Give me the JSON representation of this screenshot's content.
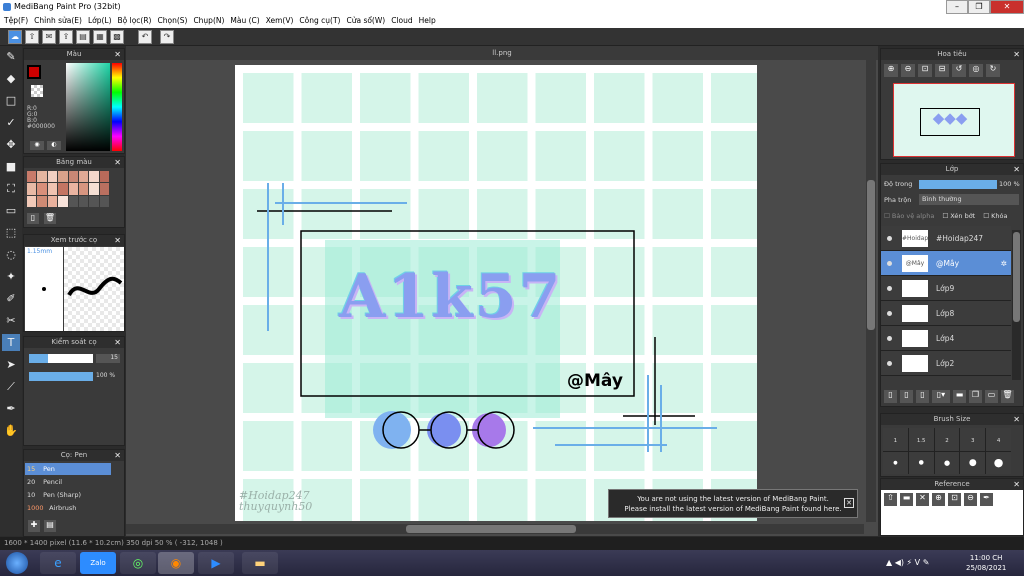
{
  "window": {
    "title": "MediBang Paint Pro (32bit)"
  },
  "menu": [
    "Tệp(F)",
    "Chỉnh sửa(E)",
    "Lớp(L)",
    "Bộ lọc(R)",
    "Chọn(S)",
    "Chụp(N)",
    "Màu (C)",
    "Xem(V)",
    "Công cụ(T)",
    "Cửa sổ(W)",
    "Cloud",
    "Help"
  ],
  "panels": {
    "color": {
      "title": "Màu",
      "r": "R:0",
      "g": "G:0",
      "b": "B:0",
      "hex": "#000000"
    },
    "palette": {
      "title": "Bảng màu"
    },
    "preview": {
      "title": "Xem trước cọ",
      "size": "1.15mm"
    },
    "brushctl": {
      "title": "Kiểm soát cọ",
      "size": "15",
      "opacity": "100 %"
    },
    "brush": {
      "title": "Cọ: Pen",
      "items": [
        {
          "size": "15",
          "name": "Pen"
        },
        {
          "size": "20",
          "name": "Pencil"
        },
        {
          "size": "10",
          "name": "Pen (Sharp)"
        },
        {
          "size": "1000",
          "name": "Airbrush"
        }
      ]
    }
  },
  "document": {
    "tab": "ll.png",
    "title_art": "A1k57",
    "handle": "@Mây",
    "credit1": "#Hoidap247",
    "credit2": "thuyquynh50"
  },
  "navigator": {
    "title": "Hoa tiêu"
  },
  "layers": {
    "title": "Lớp",
    "opacity_label": "Độ trong",
    "opacity": "100 %",
    "blend_label": "Pha trộn",
    "blend": "Bình thường",
    "protect": "Bảo vệ alpha",
    "clip": "Xén bớt",
    "lock": "Khóa",
    "items": [
      {
        "name": "#Hoidap247",
        "thumb": "#Hoidap"
      },
      {
        "name": "@Mây",
        "thumb": "@Mây"
      },
      {
        "name": "Lớp9",
        "thumb": ""
      },
      {
        "name": "Lớp8",
        "thumb": ""
      },
      {
        "name": "Lớp4",
        "thumb": ""
      },
      {
        "name": "Lớp2",
        "thumb": ""
      }
    ]
  },
  "brushsize": {
    "title": "Brush Size",
    "values": [
      "1",
      "1.5",
      "2",
      "3",
      "4"
    ]
  },
  "reference": {
    "title": "Reference"
  },
  "notice": {
    "line1": "You are not using the latest version of MediBang Paint.",
    "line2": "Please install the latest version of MediBang Paint found here."
  },
  "status": {
    "text": "1600 * 1400 pixel  (11.6 * 10.2cm)  350 dpi  50 %  ( -312, 1048 )"
  },
  "clock": {
    "time": "11:00 CH",
    "date": "25/08/2021"
  }
}
